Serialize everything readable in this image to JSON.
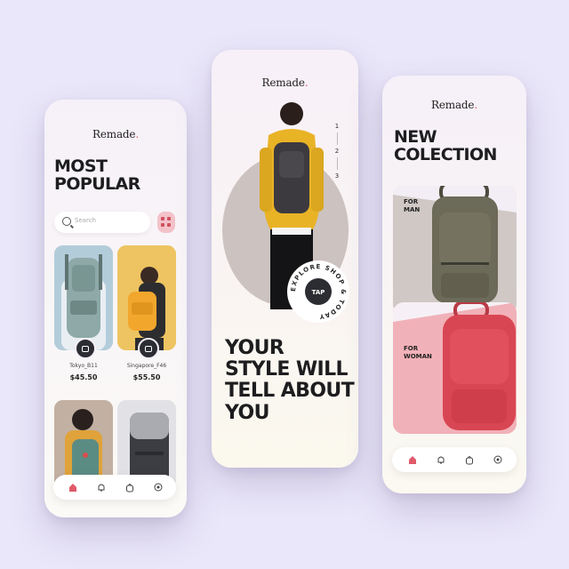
{
  "brand": {
    "name": "Remade",
    "dot": "."
  },
  "left": {
    "title_line1": "MOST",
    "title_line2": "POPULAR",
    "search_placeholder": "Search",
    "products": [
      {
        "name": "Tokyo_B11",
        "price": "$45.50"
      },
      {
        "name": "Singapore_F46",
        "price": "$55.50"
      }
    ]
  },
  "middle": {
    "pager": [
      "1",
      "2",
      "3"
    ],
    "badge_ring_text": "EXPLORE SHOP & TODAY",
    "badge_label": "TAP",
    "headline_lines": [
      "YOUR",
      "STYLE WILL",
      "TELL ABOUT",
      "YOU"
    ]
  },
  "right": {
    "title_line1": "NEW",
    "title_line2": "COLECTION",
    "categories": [
      {
        "line1": "FOR",
        "line2": "MAN"
      },
      {
        "line1": "FOR",
        "line2": "WOMAN"
      }
    ]
  },
  "nav_icons": [
    "home-icon",
    "bell-icon",
    "bag-icon",
    "settings-icon"
  ],
  "colors": {
    "accent": "#e05a6a",
    "background": "#ebe7fa",
    "dark": "#1d1d1f"
  }
}
